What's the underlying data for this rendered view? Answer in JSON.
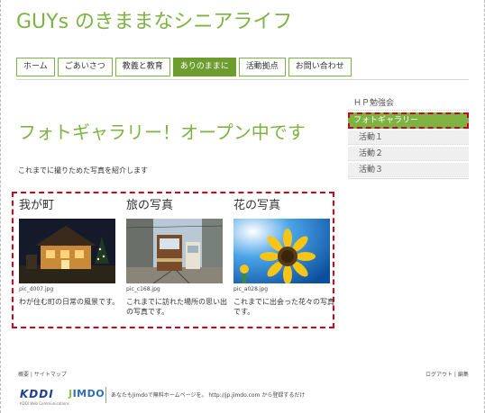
{
  "site": {
    "title": "GUYs のきままなシニアライフ"
  },
  "nav": {
    "items": [
      {
        "label": "ホーム"
      },
      {
        "label": "ごあいさつ"
      },
      {
        "label": "教義と教育"
      },
      {
        "label": "ありのままに",
        "active": true
      },
      {
        "label": "活動拠点"
      },
      {
        "label": "お問い合わせ"
      }
    ]
  },
  "sidebar": {
    "items": [
      {
        "label": "ＨＰ勉強会"
      },
      {
        "label": "フォトギャラリー",
        "active": true
      },
      {
        "label": "活動１"
      },
      {
        "label": "活動２"
      },
      {
        "label": "活動３"
      }
    ]
  },
  "main": {
    "heading": "フォトギャラリー！オープン中です",
    "intro": "これまでに撮りためた写真を紹介します"
  },
  "gallery": {
    "items": [
      {
        "title": "我が町",
        "filename": "pic_d007.jpg",
        "caption": "わが住む町の日常の風景です。"
      },
      {
        "title": "旅の写真",
        "filename": "pic_c168.jpg",
        "caption": "これまでに訪れた場所の思い出の写真です。"
      },
      {
        "title": "花の写真",
        "filename": "pic_a028.jpg",
        "caption": "これまでに出会った花々の写真です。"
      }
    ]
  },
  "footer": {
    "left": "概要 | サイトマップ",
    "right": "ログアウト | 編集",
    "kddi": "KDDI",
    "kddi_sub": "KDDI Web Communications",
    "jimdo_j": "J",
    "jimdo_rest": "IMDO",
    "tagline": "あなたもJimdoで無料ホームページを。 http://jp.jimdo.com から登録するだけ"
  },
  "colors": {
    "accent": "#7cb342",
    "active_nav": "#6d9d2f",
    "highlight_border": "#d0021b"
  },
  "icons": {
    "photo1": "house-night-photo",
    "photo2": "tram-photo",
    "photo3": "sunflower-photo"
  }
}
